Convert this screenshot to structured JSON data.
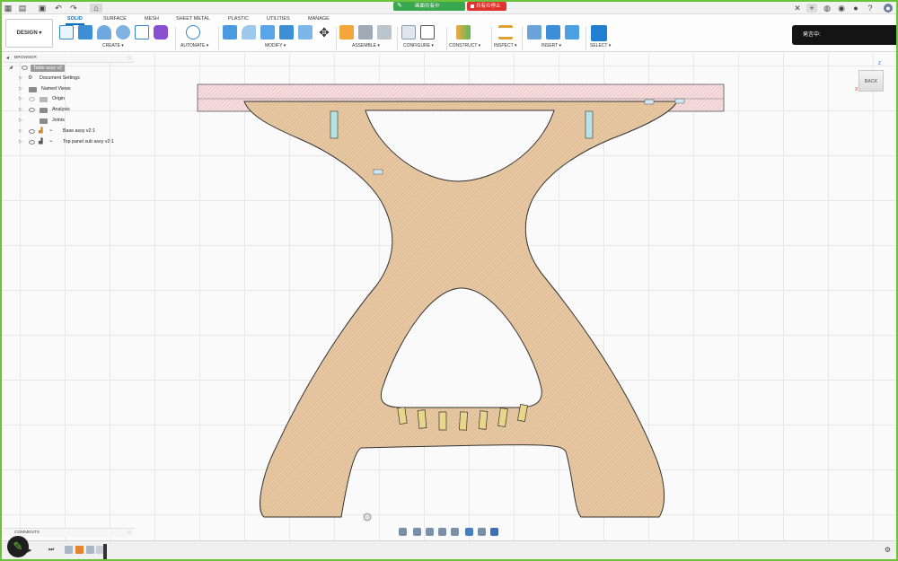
{
  "share": {
    "active_label": "画面共有中",
    "stop_label": "共有の停止",
    "doc_title": "Table assy"
  },
  "toolbar": {
    "workspace": "DESIGN ▾",
    "tabs": [
      "SOLID",
      "SURFACE",
      "MESH",
      "SHEET METAL",
      "PLASTIC",
      "UTILITIES",
      "MANAGE"
    ],
    "groups": [
      "CREATE ▾",
      "AUTOMATE ▾",
      "MODIFY ▾",
      "ASSEMBLE ▾",
      "CONFIGURE ▾",
      "CONSTRUCT ▾",
      "INSPECT ▾",
      "INSERT ▾",
      "SELECT ▾"
    ]
  },
  "notification": "発言中:",
  "browser": {
    "title": "BROWSER",
    "root": "Table assy v2",
    "items": [
      "Document Settings",
      "Named Views",
      "Origin",
      "Analysis",
      "Joints",
      "Base assy v2:1",
      "Top panel sub assy v2:1"
    ]
  },
  "viewcube": {
    "face": "BACK",
    "axis_z": "Z",
    "axis_x": "X"
  },
  "comments": {
    "title": "COMMENTS"
  },
  "colors": {
    "accent": "#0a6ebd",
    "share_green": "#3aa84f",
    "stop_red": "#e0322f",
    "wood": "#e8c9a4",
    "top_panel": "#f6dcdc"
  },
  "icons": [
    "grid-icon",
    "file-icon",
    "save-icon",
    "undo-icon",
    "redo-icon",
    "home-icon",
    "pen-icon",
    "gear-icon",
    "eye-icon",
    "folder-icon",
    "link-icon",
    "pencil-icon",
    "play-icon",
    "close-icon",
    "plus-icon",
    "bell-icon",
    "help-icon",
    "user-icon"
  ]
}
